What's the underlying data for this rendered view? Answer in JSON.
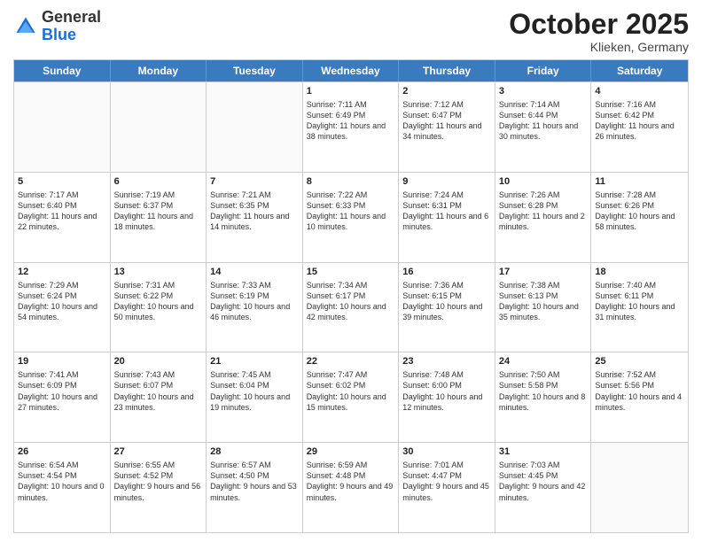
{
  "header": {
    "logo_general": "General",
    "logo_blue": "Blue",
    "month_title": "October 2025",
    "subtitle": "Klieken, Germany"
  },
  "days_of_week": [
    "Sunday",
    "Monday",
    "Tuesday",
    "Wednesday",
    "Thursday",
    "Friday",
    "Saturday"
  ],
  "weeks": [
    [
      {
        "day": "",
        "sunrise": "",
        "sunset": "",
        "daylight": "",
        "empty": true
      },
      {
        "day": "",
        "sunrise": "",
        "sunset": "",
        "daylight": "",
        "empty": true
      },
      {
        "day": "",
        "sunrise": "",
        "sunset": "",
        "daylight": "",
        "empty": true
      },
      {
        "day": "1",
        "sunrise": "Sunrise: 7:11 AM",
        "sunset": "Sunset: 6:49 PM",
        "daylight": "Daylight: 11 hours and 38 minutes."
      },
      {
        "day": "2",
        "sunrise": "Sunrise: 7:12 AM",
        "sunset": "Sunset: 6:47 PM",
        "daylight": "Daylight: 11 hours and 34 minutes."
      },
      {
        "day": "3",
        "sunrise": "Sunrise: 7:14 AM",
        "sunset": "Sunset: 6:44 PM",
        "daylight": "Daylight: 11 hours and 30 minutes."
      },
      {
        "day": "4",
        "sunrise": "Sunrise: 7:16 AM",
        "sunset": "Sunset: 6:42 PM",
        "daylight": "Daylight: 11 hours and 26 minutes."
      }
    ],
    [
      {
        "day": "5",
        "sunrise": "Sunrise: 7:17 AM",
        "sunset": "Sunset: 6:40 PM",
        "daylight": "Daylight: 11 hours and 22 minutes."
      },
      {
        "day": "6",
        "sunrise": "Sunrise: 7:19 AM",
        "sunset": "Sunset: 6:37 PM",
        "daylight": "Daylight: 11 hours and 18 minutes."
      },
      {
        "day": "7",
        "sunrise": "Sunrise: 7:21 AM",
        "sunset": "Sunset: 6:35 PM",
        "daylight": "Daylight: 11 hours and 14 minutes."
      },
      {
        "day": "8",
        "sunrise": "Sunrise: 7:22 AM",
        "sunset": "Sunset: 6:33 PM",
        "daylight": "Daylight: 11 hours and 10 minutes."
      },
      {
        "day": "9",
        "sunrise": "Sunrise: 7:24 AM",
        "sunset": "Sunset: 6:31 PM",
        "daylight": "Daylight: 11 hours and 6 minutes."
      },
      {
        "day": "10",
        "sunrise": "Sunrise: 7:26 AM",
        "sunset": "Sunset: 6:28 PM",
        "daylight": "Daylight: 11 hours and 2 minutes."
      },
      {
        "day": "11",
        "sunrise": "Sunrise: 7:28 AM",
        "sunset": "Sunset: 6:26 PM",
        "daylight": "Daylight: 10 hours and 58 minutes."
      }
    ],
    [
      {
        "day": "12",
        "sunrise": "Sunrise: 7:29 AM",
        "sunset": "Sunset: 6:24 PM",
        "daylight": "Daylight: 10 hours and 54 minutes."
      },
      {
        "day": "13",
        "sunrise": "Sunrise: 7:31 AM",
        "sunset": "Sunset: 6:22 PM",
        "daylight": "Daylight: 10 hours and 50 minutes."
      },
      {
        "day": "14",
        "sunrise": "Sunrise: 7:33 AM",
        "sunset": "Sunset: 6:19 PM",
        "daylight": "Daylight: 10 hours and 46 minutes."
      },
      {
        "day": "15",
        "sunrise": "Sunrise: 7:34 AM",
        "sunset": "Sunset: 6:17 PM",
        "daylight": "Daylight: 10 hours and 42 minutes."
      },
      {
        "day": "16",
        "sunrise": "Sunrise: 7:36 AM",
        "sunset": "Sunset: 6:15 PM",
        "daylight": "Daylight: 10 hours and 39 minutes."
      },
      {
        "day": "17",
        "sunrise": "Sunrise: 7:38 AM",
        "sunset": "Sunset: 6:13 PM",
        "daylight": "Daylight: 10 hours and 35 minutes."
      },
      {
        "day": "18",
        "sunrise": "Sunrise: 7:40 AM",
        "sunset": "Sunset: 6:11 PM",
        "daylight": "Daylight: 10 hours and 31 minutes."
      }
    ],
    [
      {
        "day": "19",
        "sunrise": "Sunrise: 7:41 AM",
        "sunset": "Sunset: 6:09 PM",
        "daylight": "Daylight: 10 hours and 27 minutes."
      },
      {
        "day": "20",
        "sunrise": "Sunrise: 7:43 AM",
        "sunset": "Sunset: 6:07 PM",
        "daylight": "Daylight: 10 hours and 23 minutes."
      },
      {
        "day": "21",
        "sunrise": "Sunrise: 7:45 AM",
        "sunset": "Sunset: 6:04 PM",
        "daylight": "Daylight: 10 hours and 19 minutes."
      },
      {
        "day": "22",
        "sunrise": "Sunrise: 7:47 AM",
        "sunset": "Sunset: 6:02 PM",
        "daylight": "Daylight: 10 hours and 15 minutes."
      },
      {
        "day": "23",
        "sunrise": "Sunrise: 7:48 AM",
        "sunset": "Sunset: 6:00 PM",
        "daylight": "Daylight: 10 hours and 12 minutes."
      },
      {
        "day": "24",
        "sunrise": "Sunrise: 7:50 AM",
        "sunset": "Sunset: 5:58 PM",
        "daylight": "Daylight: 10 hours and 8 minutes."
      },
      {
        "day": "25",
        "sunrise": "Sunrise: 7:52 AM",
        "sunset": "Sunset: 5:56 PM",
        "daylight": "Daylight: 10 hours and 4 minutes."
      }
    ],
    [
      {
        "day": "26",
        "sunrise": "Sunrise: 6:54 AM",
        "sunset": "Sunset: 4:54 PM",
        "daylight": "Daylight: 10 hours and 0 minutes."
      },
      {
        "day": "27",
        "sunrise": "Sunrise: 6:55 AM",
        "sunset": "Sunset: 4:52 PM",
        "daylight": "Daylight: 9 hours and 56 minutes."
      },
      {
        "day": "28",
        "sunrise": "Sunrise: 6:57 AM",
        "sunset": "Sunset: 4:50 PM",
        "daylight": "Daylight: 9 hours and 53 minutes."
      },
      {
        "day": "29",
        "sunrise": "Sunrise: 6:59 AM",
        "sunset": "Sunset: 4:48 PM",
        "daylight": "Daylight: 9 hours and 49 minutes."
      },
      {
        "day": "30",
        "sunrise": "Sunrise: 7:01 AM",
        "sunset": "Sunset: 4:47 PM",
        "daylight": "Daylight: 9 hours and 45 minutes."
      },
      {
        "day": "31",
        "sunrise": "Sunrise: 7:03 AM",
        "sunset": "Sunset: 4:45 PM",
        "daylight": "Daylight: 9 hours and 42 minutes."
      },
      {
        "day": "",
        "sunrise": "",
        "sunset": "",
        "daylight": "",
        "empty": true
      }
    ]
  ]
}
